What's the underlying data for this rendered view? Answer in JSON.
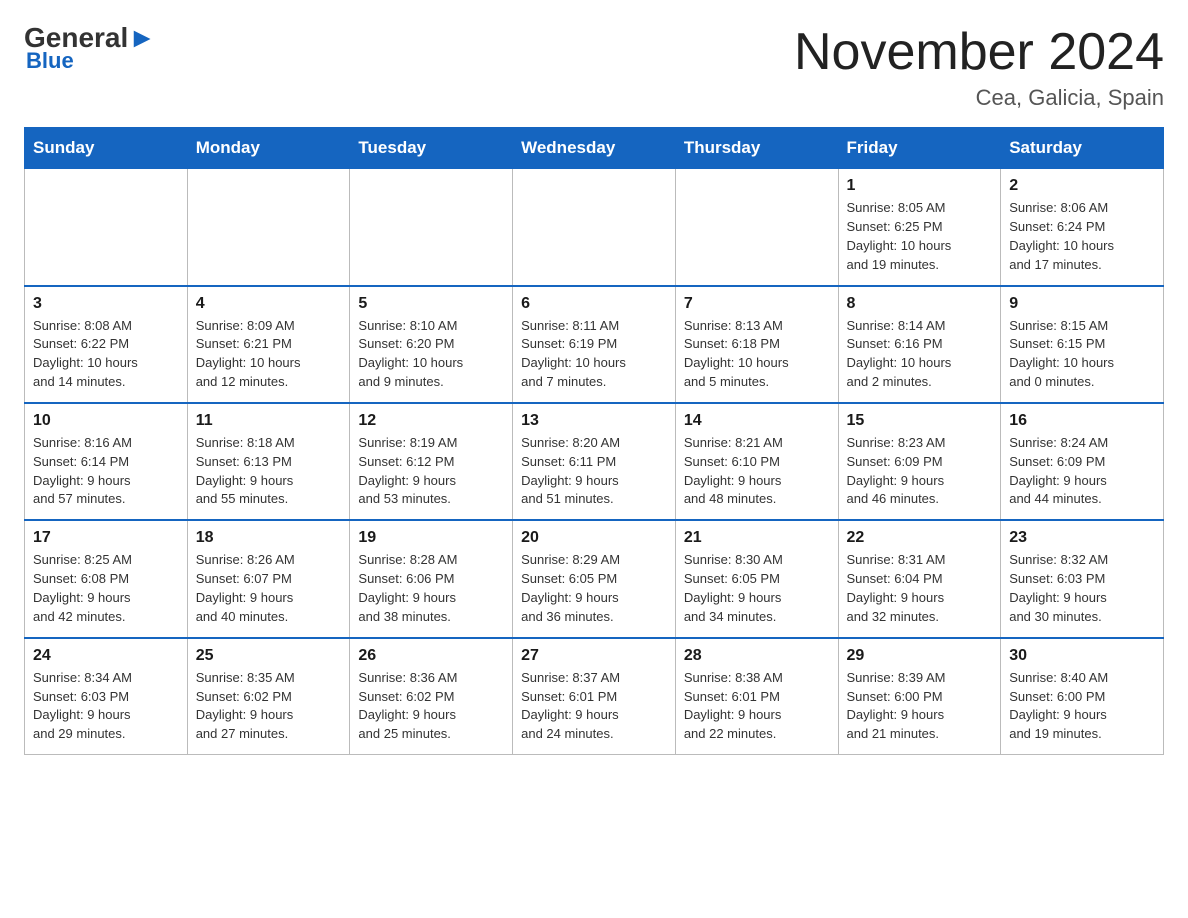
{
  "header": {
    "logo_general": "General",
    "logo_blue": "Blue",
    "title": "November 2024",
    "subtitle": "Cea, Galicia, Spain"
  },
  "weekdays": [
    "Sunday",
    "Monday",
    "Tuesday",
    "Wednesday",
    "Thursday",
    "Friday",
    "Saturday"
  ],
  "weeks": [
    [
      {
        "day": "",
        "info": ""
      },
      {
        "day": "",
        "info": ""
      },
      {
        "day": "",
        "info": ""
      },
      {
        "day": "",
        "info": ""
      },
      {
        "day": "",
        "info": ""
      },
      {
        "day": "1",
        "info": "Sunrise: 8:05 AM\nSunset: 6:25 PM\nDaylight: 10 hours\nand 19 minutes."
      },
      {
        "day": "2",
        "info": "Sunrise: 8:06 AM\nSunset: 6:24 PM\nDaylight: 10 hours\nand 17 minutes."
      }
    ],
    [
      {
        "day": "3",
        "info": "Sunrise: 8:08 AM\nSunset: 6:22 PM\nDaylight: 10 hours\nand 14 minutes."
      },
      {
        "day": "4",
        "info": "Sunrise: 8:09 AM\nSunset: 6:21 PM\nDaylight: 10 hours\nand 12 minutes."
      },
      {
        "day": "5",
        "info": "Sunrise: 8:10 AM\nSunset: 6:20 PM\nDaylight: 10 hours\nand 9 minutes."
      },
      {
        "day": "6",
        "info": "Sunrise: 8:11 AM\nSunset: 6:19 PM\nDaylight: 10 hours\nand 7 minutes."
      },
      {
        "day": "7",
        "info": "Sunrise: 8:13 AM\nSunset: 6:18 PM\nDaylight: 10 hours\nand 5 minutes."
      },
      {
        "day": "8",
        "info": "Sunrise: 8:14 AM\nSunset: 6:16 PM\nDaylight: 10 hours\nand 2 minutes."
      },
      {
        "day": "9",
        "info": "Sunrise: 8:15 AM\nSunset: 6:15 PM\nDaylight: 10 hours\nand 0 minutes."
      }
    ],
    [
      {
        "day": "10",
        "info": "Sunrise: 8:16 AM\nSunset: 6:14 PM\nDaylight: 9 hours\nand 57 minutes."
      },
      {
        "day": "11",
        "info": "Sunrise: 8:18 AM\nSunset: 6:13 PM\nDaylight: 9 hours\nand 55 minutes."
      },
      {
        "day": "12",
        "info": "Sunrise: 8:19 AM\nSunset: 6:12 PM\nDaylight: 9 hours\nand 53 minutes."
      },
      {
        "day": "13",
        "info": "Sunrise: 8:20 AM\nSunset: 6:11 PM\nDaylight: 9 hours\nand 51 minutes."
      },
      {
        "day": "14",
        "info": "Sunrise: 8:21 AM\nSunset: 6:10 PM\nDaylight: 9 hours\nand 48 minutes."
      },
      {
        "day": "15",
        "info": "Sunrise: 8:23 AM\nSunset: 6:09 PM\nDaylight: 9 hours\nand 46 minutes."
      },
      {
        "day": "16",
        "info": "Sunrise: 8:24 AM\nSunset: 6:09 PM\nDaylight: 9 hours\nand 44 minutes."
      }
    ],
    [
      {
        "day": "17",
        "info": "Sunrise: 8:25 AM\nSunset: 6:08 PM\nDaylight: 9 hours\nand 42 minutes."
      },
      {
        "day": "18",
        "info": "Sunrise: 8:26 AM\nSunset: 6:07 PM\nDaylight: 9 hours\nand 40 minutes."
      },
      {
        "day": "19",
        "info": "Sunrise: 8:28 AM\nSunset: 6:06 PM\nDaylight: 9 hours\nand 38 minutes."
      },
      {
        "day": "20",
        "info": "Sunrise: 8:29 AM\nSunset: 6:05 PM\nDaylight: 9 hours\nand 36 minutes."
      },
      {
        "day": "21",
        "info": "Sunrise: 8:30 AM\nSunset: 6:05 PM\nDaylight: 9 hours\nand 34 minutes."
      },
      {
        "day": "22",
        "info": "Sunrise: 8:31 AM\nSunset: 6:04 PM\nDaylight: 9 hours\nand 32 minutes."
      },
      {
        "day": "23",
        "info": "Sunrise: 8:32 AM\nSunset: 6:03 PM\nDaylight: 9 hours\nand 30 minutes."
      }
    ],
    [
      {
        "day": "24",
        "info": "Sunrise: 8:34 AM\nSunset: 6:03 PM\nDaylight: 9 hours\nand 29 minutes."
      },
      {
        "day": "25",
        "info": "Sunrise: 8:35 AM\nSunset: 6:02 PM\nDaylight: 9 hours\nand 27 minutes."
      },
      {
        "day": "26",
        "info": "Sunrise: 8:36 AM\nSunset: 6:02 PM\nDaylight: 9 hours\nand 25 minutes."
      },
      {
        "day": "27",
        "info": "Sunrise: 8:37 AM\nSunset: 6:01 PM\nDaylight: 9 hours\nand 24 minutes."
      },
      {
        "day": "28",
        "info": "Sunrise: 8:38 AM\nSunset: 6:01 PM\nDaylight: 9 hours\nand 22 minutes."
      },
      {
        "day": "29",
        "info": "Sunrise: 8:39 AM\nSunset: 6:00 PM\nDaylight: 9 hours\nand 21 minutes."
      },
      {
        "day": "30",
        "info": "Sunrise: 8:40 AM\nSunset: 6:00 PM\nDaylight: 9 hours\nand 19 minutes."
      }
    ]
  ]
}
